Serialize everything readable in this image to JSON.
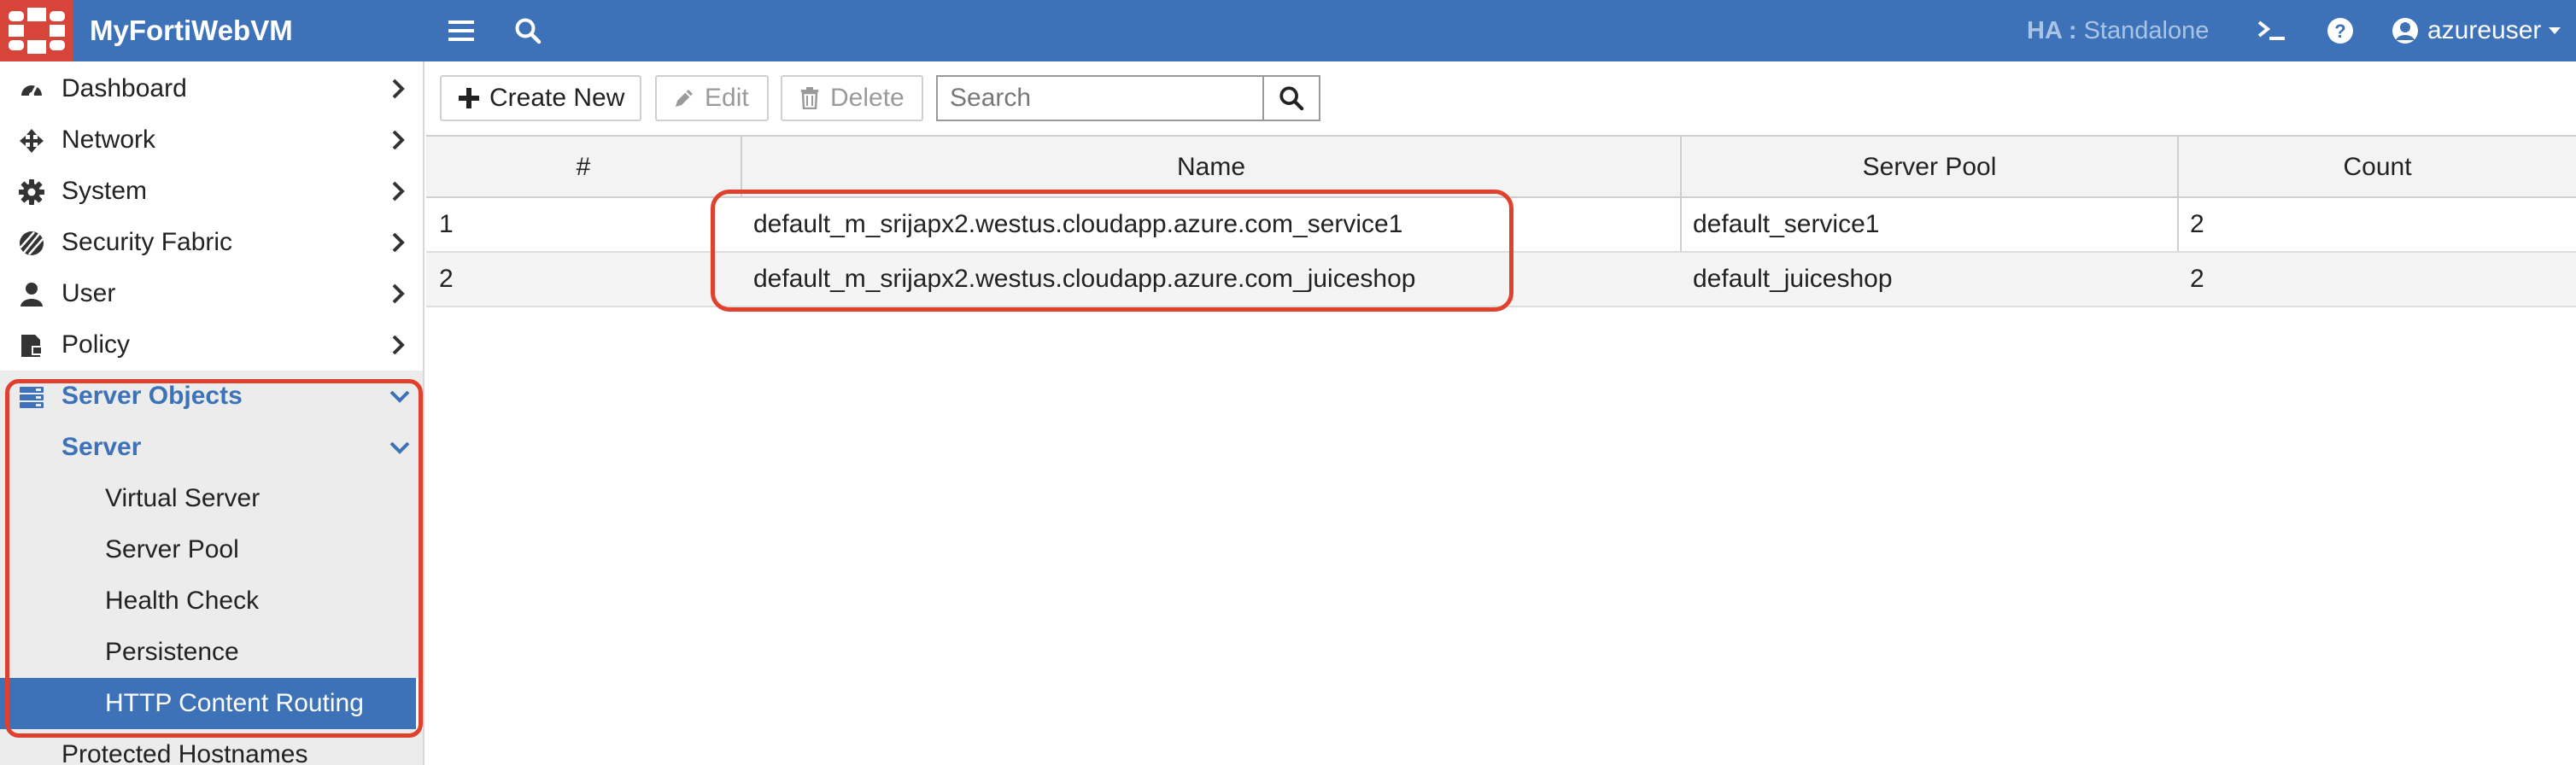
{
  "app": {
    "title": "MyFortiWebVM"
  },
  "header": {
    "ha_label": "HA :",
    "ha_value": "Standalone",
    "user_name": "azureuser",
    "icons": [
      "menu-icon",
      "search-icon",
      "cli-console-icon",
      "help-icon",
      "user-icon"
    ]
  },
  "sidebar": {
    "items": [
      {
        "label": "Dashboard",
        "icon": "dashboard-icon"
      },
      {
        "label": "Network",
        "icon": "network-icon"
      },
      {
        "label": "System",
        "icon": "gear-icon"
      },
      {
        "label": "Security Fabric",
        "icon": "security-fabric-icon"
      },
      {
        "label": "User",
        "icon": "user-icon"
      },
      {
        "label": "Policy",
        "icon": "policy-icon"
      },
      {
        "label": "Server Objects",
        "icon": "server-objects-icon",
        "expanded": true
      },
      {
        "label": "Server",
        "expanded": true
      },
      {
        "label": "Virtual Server"
      },
      {
        "label": "Server Pool"
      },
      {
        "label": "Health Check"
      },
      {
        "label": "Persistence"
      },
      {
        "label": "HTTP Content Routing",
        "active": true
      },
      {
        "label": "Protected Hostnames"
      }
    ]
  },
  "toolbar": {
    "create_label": "Create New",
    "edit_label": "Edit",
    "delete_label": "Delete",
    "search_placeholder": "Search"
  },
  "table": {
    "columns": [
      "#",
      "Name",
      "Server Pool",
      "Count"
    ],
    "rows": [
      [
        "1",
        "default_m_srijapx2.westus.cloudapp.azure.com_service1",
        "default_service1",
        "2"
      ],
      [
        "2",
        "default_m_srijapx2.westus.cloudapp.azure.com_juiceshop",
        "default_juiceshop",
        "2"
      ]
    ]
  },
  "colors": {
    "brand_blue": "#3d72b8",
    "logo_red": "#d6443a",
    "highlight_red": "#e0412e"
  }
}
